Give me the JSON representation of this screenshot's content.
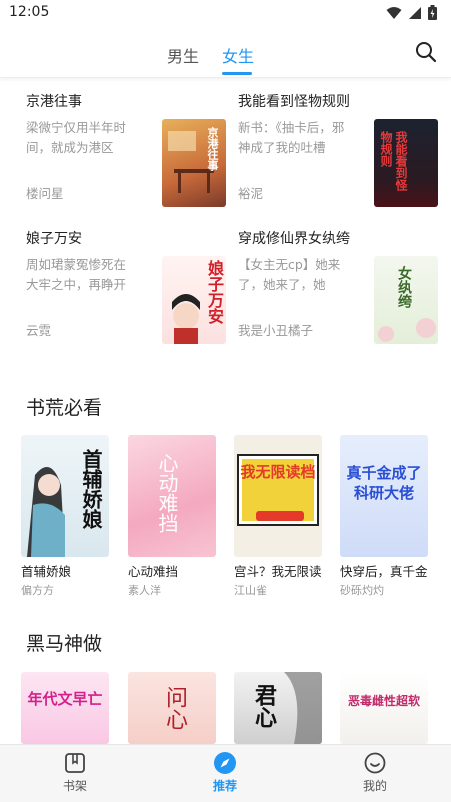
{
  "status": {
    "time": "12:05"
  },
  "tabs": [
    {
      "label": "男生"
    },
    {
      "label": "女生"
    }
  ],
  "list": [
    {
      "title": "京港往事",
      "desc": "梁微宁仅用半年时间，就成为港区资...",
      "author": "楼问星",
      "cover_text": "京港往事"
    },
    {
      "title": "我能看到怪物规则",
      "desc": "新书：《抽卡后，邪神成了我的吐槽役...",
      "author": "裕泥",
      "cover_text": "我能看到怪物规则"
    },
    {
      "title": "娘子万安",
      "desc": "周如珺蒙冤惨死在大牢之中，再睁开眼...",
      "author": "云霓",
      "cover_text": "娘子万安"
    },
    {
      "title": "穿成修仙界女纨绔",
      "desc": "【女主无cp】她来了，她来了，她骑...",
      "author": "我是小丑橘子",
      "cover_text": "女纨绔"
    }
  ],
  "section1": {
    "title": "书荒必看",
    "items": [
      {
        "name": "首辅娇娘",
        "author": "偏方方",
        "cover_text": "首辅娇娘"
      },
      {
        "name": "心动难挡",
        "author": "素人洋",
        "cover_text": "心动难挡"
      },
      {
        "name": "宫斗？我无限读档",
        "author": "江山雀",
        "cover_text": "我无限读档"
      },
      {
        "name": "快穿后，真千金成了科研大佬",
        "author": "砂砾灼灼",
        "cover_text": "真千金成了科研大佬"
      }
    ]
  },
  "section2": {
    "title": "黑马神做",
    "items": [
      {
        "cover_text": "年代文早亡"
      },
      {
        "cover_text": "问心"
      },
      {
        "cover_text": "君心"
      },
      {
        "cover_text": "恶毒雌性超软"
      }
    ]
  },
  "nav": [
    {
      "label": "书架"
    },
    {
      "label": "推荐"
    },
    {
      "label": "我的"
    }
  ],
  "colors": {
    "accent": "#2196f3"
  }
}
